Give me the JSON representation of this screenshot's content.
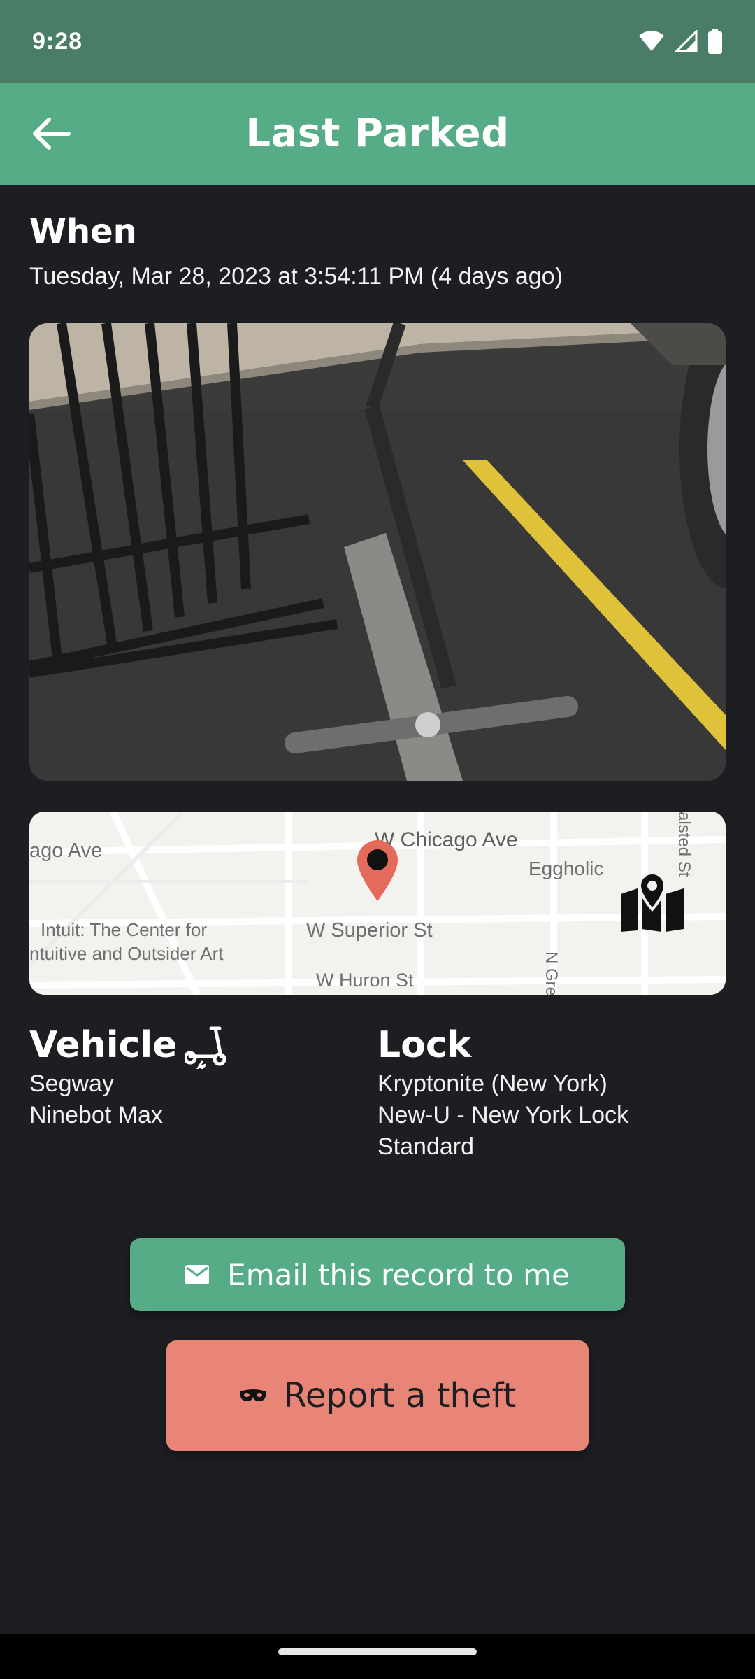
{
  "status_bar": {
    "time": "9:28",
    "icons": [
      "wifi-icon",
      "cell-signal-icon",
      "battery-icon"
    ]
  },
  "app_bar": {
    "back_icon": "arrow-left-icon",
    "title": "Last Parked"
  },
  "when": {
    "heading": "When",
    "value": "Tuesday, Mar 28, 2023 at 3:54:11 PM (4 days ago)"
  },
  "map": {
    "labels": {
      "chicago": "W Chicago Ave",
      "ago": "ago Ave",
      "eggholic": "Eggholic",
      "intuit1": "Intuit: The Center for",
      "intuit2": "ntuitive and Outsider Art",
      "superior": "W Superior St",
      "huron": "W Huron St",
      "green": "N Green St",
      "halsted": "alsted St"
    },
    "pin_icon": "map-pin-icon",
    "open_map_icon": "folded-map-icon"
  },
  "vehicle": {
    "heading": "Vehicle",
    "icon": "scooter-icon",
    "lines": [
      "Segway",
      "Ninebot Max"
    ]
  },
  "lock": {
    "heading": "Lock",
    "lines": [
      "Kryptonite (New York)",
      "New-U - New York Lock",
      "Standard"
    ]
  },
  "actions": {
    "email_label": "Email this record to me",
    "email_icon": "envelope-icon",
    "theft_label": "Report a theft",
    "theft_icon": "mask-icon"
  },
  "colors": {
    "status_bar": "#4a7d66",
    "app_bar": "#57ac88",
    "background": "#1c1e22",
    "email_button": "#57ac88",
    "theft_button": "#e88577"
  }
}
